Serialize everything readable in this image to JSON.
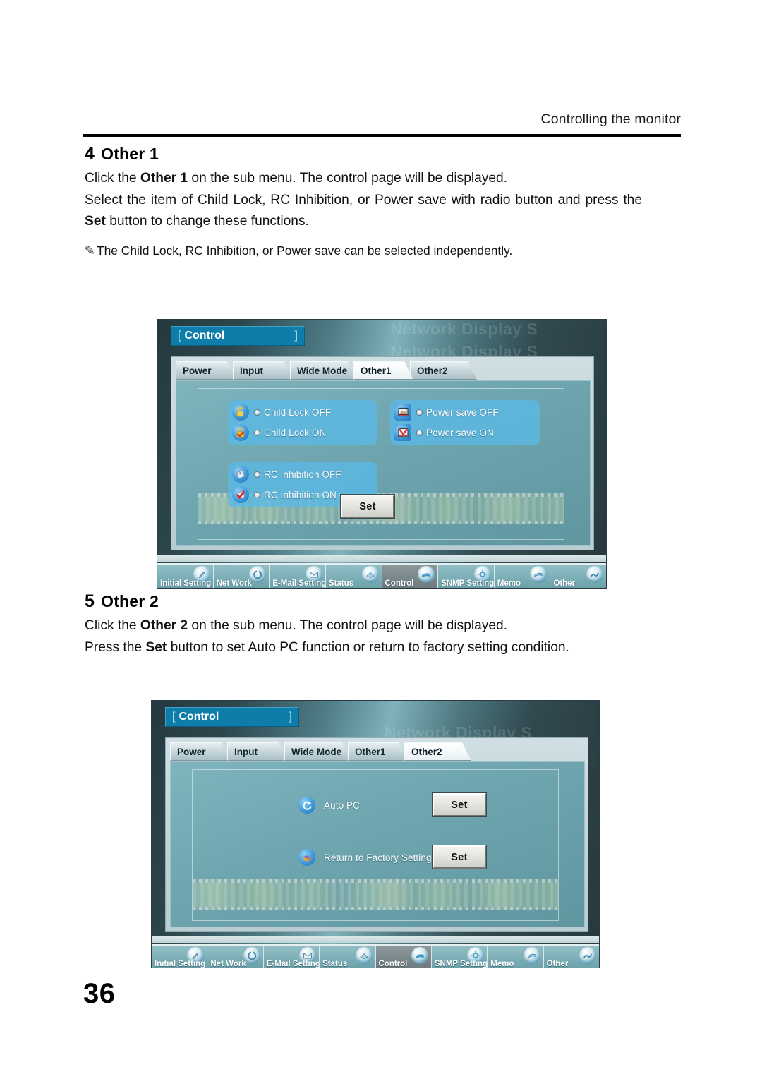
{
  "document": {
    "running_header": "Controlling the monitor",
    "page_number": "36"
  },
  "section4": {
    "number": "4",
    "title": "Other 1",
    "line1_a": "Click the ",
    "line1_b": "Other 1",
    "line1_c": " on the sub menu. The control page will be displayed.",
    "line2_a": "Select the item of Child Lock, RC Inhibition, or Power save with radio button and press the ",
    "line2_b": "Set",
    "line2_c": " button to change these functions.",
    "note": "The Child Lock, RC Inhibition, or Power save can be selected independently."
  },
  "section5": {
    "number": "5",
    "title": "Other 2",
    "line1_a": "Click the ",
    "line1_b": "Other 2",
    "line1_c": " on the sub menu. The control page will be displayed.",
    "line2_a": "Press the ",
    "line2_b": "Set",
    "line2_c": " button to set Auto PC function or return to factory setting condition."
  },
  "screenshot_other1": {
    "window_title": "Control",
    "bracket_left": "[",
    "bracket_right": "]",
    "ghost_text": "Network Display S",
    "tabs": [
      {
        "label": "Power",
        "active": false
      },
      {
        "label": "Input",
        "active": false
      },
      {
        "label": "Wide Mode",
        "active": false
      },
      {
        "label": "Other1",
        "active": true
      },
      {
        "label": "Other2",
        "active": false
      }
    ],
    "groups": {
      "child_lock": [
        {
          "label": "Child Lock OFF",
          "icon": "padlock-open-icon",
          "checked": false
        },
        {
          "label": "Child Lock ON",
          "icon": "padlock-closed-icon",
          "checked": false
        }
      ],
      "rc_inhibition": [
        {
          "label": "RC Inhibition OFF",
          "icon": "remote-control-icon",
          "checked": false
        },
        {
          "label": "RC Inhibition ON",
          "icon": "remote-control-check-icon",
          "checked": false
        }
      ],
      "power_save": [
        {
          "label": "Power save OFF",
          "icon": "monitor-icon",
          "checked": false
        },
        {
          "label": "Power save ON",
          "icon": "monitor-check-icon",
          "checked": false
        }
      ]
    },
    "set_button": "Set",
    "nav": [
      {
        "label": "Initial Setting",
        "active": false
      },
      {
        "label": "Net Work",
        "active": false
      },
      {
        "label": "E-Mail Setting",
        "active": false
      },
      {
        "label": "Status",
        "active": false
      },
      {
        "label": "Control",
        "active": true
      },
      {
        "label": "SNMP Setting",
        "active": false
      },
      {
        "label": "Memo",
        "active": false
      },
      {
        "label": "Other",
        "active": false
      }
    ]
  },
  "screenshot_other2": {
    "window_title": "Control",
    "bracket_left": "[",
    "bracket_right": "]",
    "ghost_text": "Network Display S",
    "tabs": [
      {
        "label": "Power",
        "active": false
      },
      {
        "label": "Input",
        "active": false
      },
      {
        "label": "Wide Mode",
        "active": false
      },
      {
        "label": "Other1",
        "active": false
      },
      {
        "label": "Other2",
        "active": true
      }
    ],
    "actions": [
      {
        "label": "Auto PC",
        "icon": "auto-pc-icon",
        "button": "Set"
      },
      {
        "label": "Return to Factory Setting",
        "icon": "factory-reset-icon",
        "button": "Set"
      }
    ],
    "nav": [
      {
        "label": "Initial Setting",
        "active": false
      },
      {
        "label": "Net Work",
        "active": false
      },
      {
        "label": "E-Mail Setting",
        "active": false
      },
      {
        "label": "Status",
        "active": false
      },
      {
        "label": "Control",
        "active": true
      },
      {
        "label": "SNMP Setting",
        "active": false
      },
      {
        "label": "Memo",
        "active": false
      },
      {
        "label": "Other",
        "active": false
      }
    ]
  },
  "colors": {
    "title_bar": "#0f7daa",
    "app_background": "#2e4348",
    "content_panel": "#7fb4bd",
    "option_group": "#5ab9e6",
    "nav_button": "#7fb1b9",
    "nav_button_active": "#7d8a8d",
    "accent_check": "#e02020",
    "padlock": "#f2c431"
  }
}
